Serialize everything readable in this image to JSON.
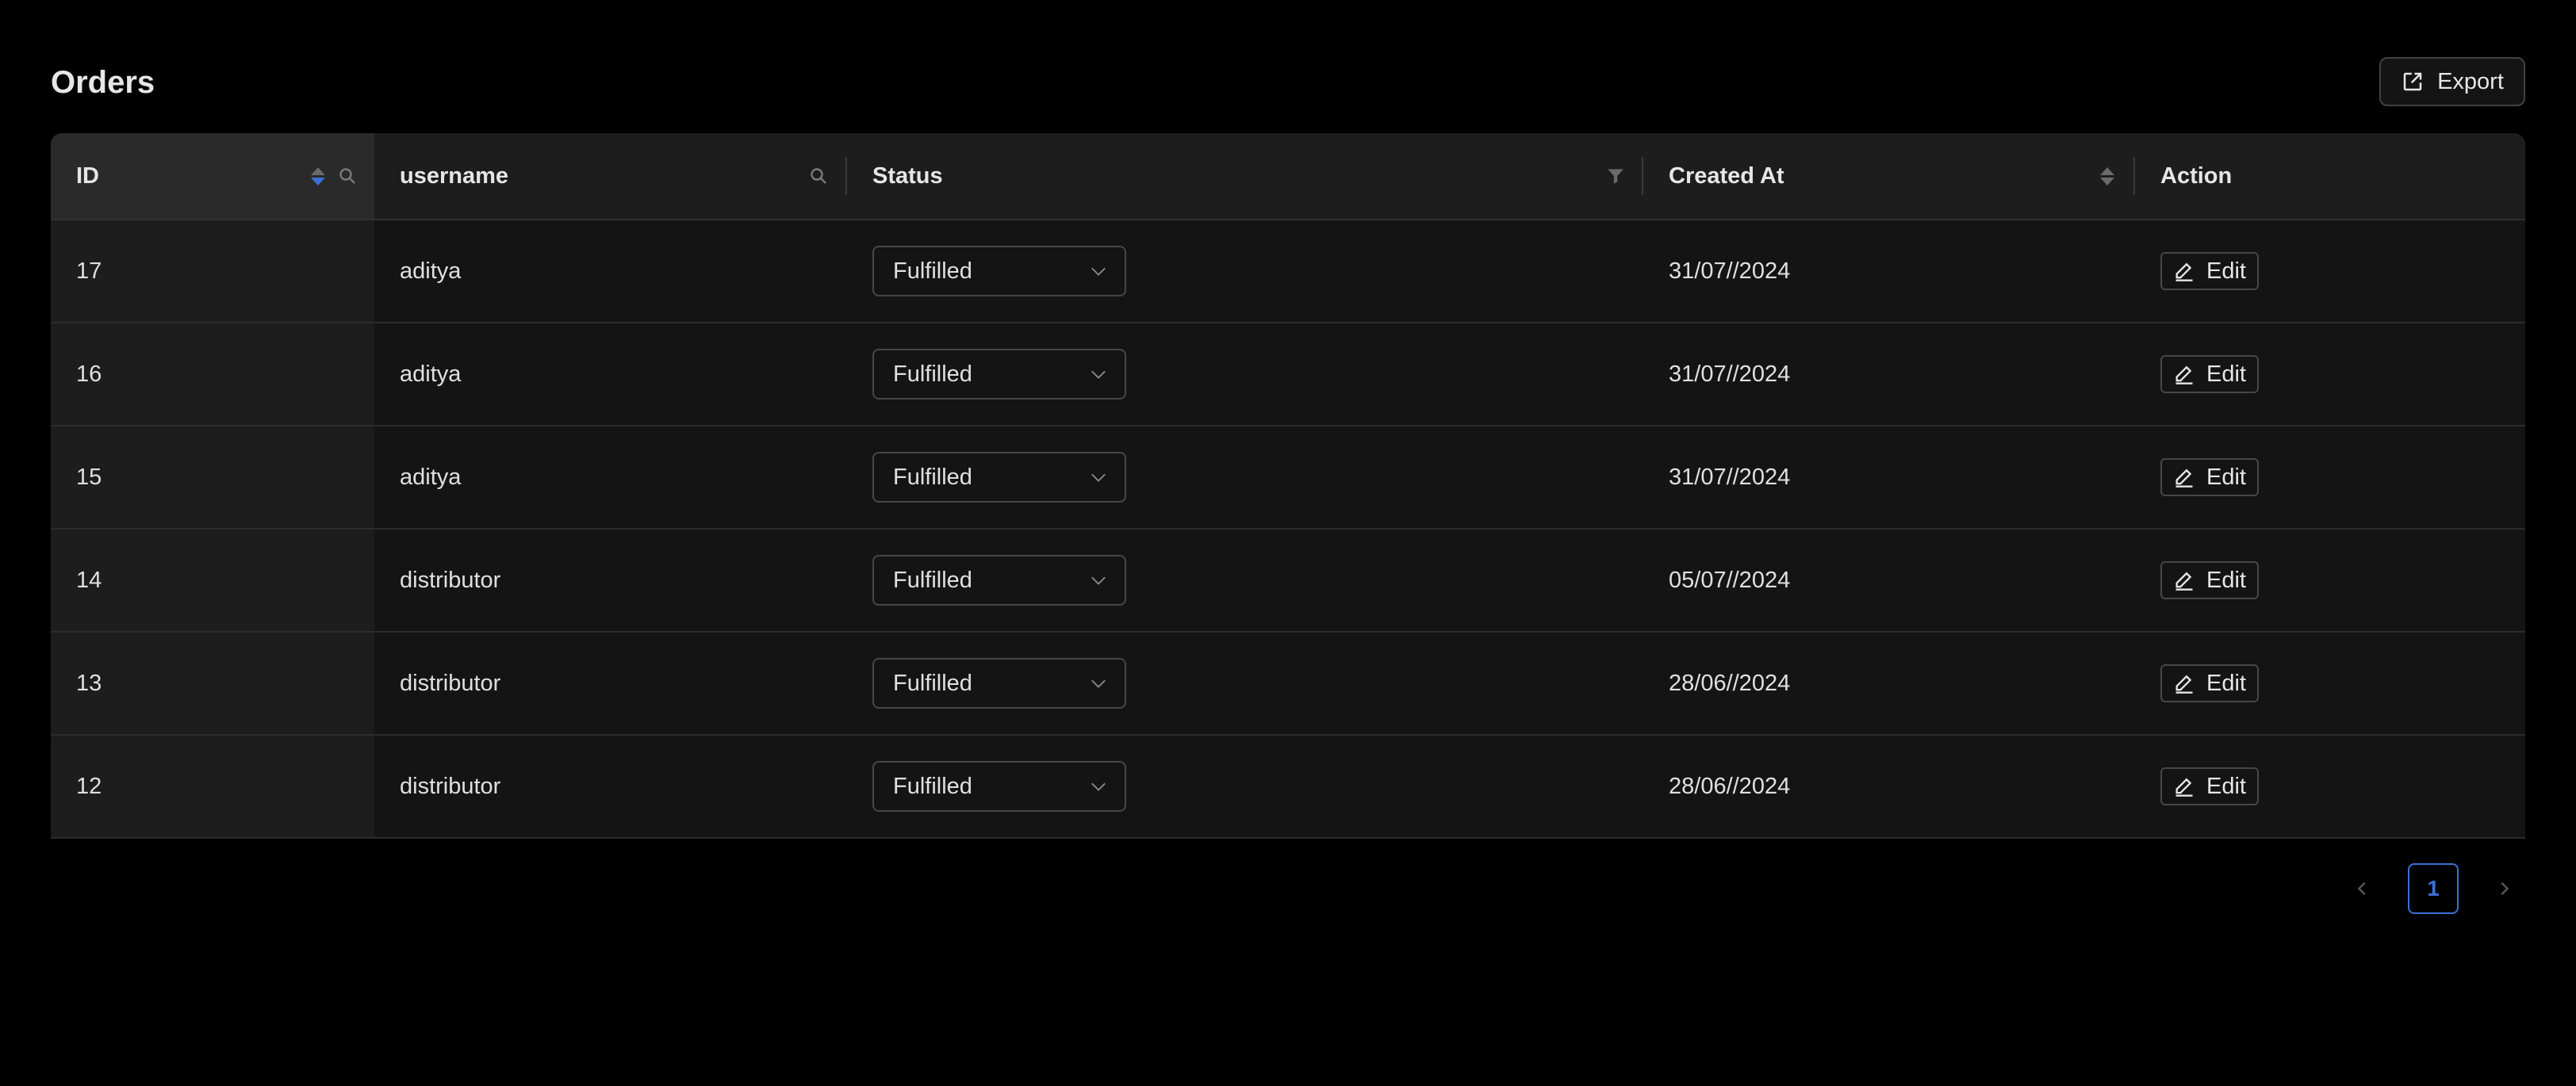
{
  "page": {
    "title": "Orders",
    "export_label": "Export"
  },
  "table": {
    "columns": [
      {
        "key": "id",
        "label": "ID",
        "sortable": true,
        "searchable": true,
        "sorted": "descend"
      },
      {
        "key": "username",
        "label": "username",
        "searchable": true
      },
      {
        "key": "status",
        "label": "Status",
        "filterable": true
      },
      {
        "key": "created_at",
        "label": "Created At",
        "sortable": true
      },
      {
        "key": "action",
        "label": "Action"
      }
    ],
    "rows": [
      {
        "id": "17",
        "username": "aditya",
        "status": "Fulfilled",
        "created_at": "31/07//2024",
        "action": "Edit"
      },
      {
        "id": "16",
        "username": "aditya",
        "status": "Fulfilled",
        "created_at": "31/07//2024",
        "action": "Edit"
      },
      {
        "id": "15",
        "username": "aditya",
        "status": "Fulfilled",
        "created_at": "31/07//2024",
        "action": "Edit"
      },
      {
        "id": "14",
        "username": "distributor",
        "status": "Fulfilled",
        "created_at": "05/07//2024",
        "action": "Edit"
      },
      {
        "id": "13",
        "username": "distributor",
        "status": "Fulfilled",
        "created_at": "28/06//2024",
        "action": "Edit"
      },
      {
        "id": "12",
        "username": "distributor",
        "status": "Fulfilled",
        "created_at": "28/06//2024",
        "action": "Edit"
      }
    ]
  },
  "pagination": {
    "current_page": "1"
  },
  "icons": {
    "export": "export-icon",
    "search": "search-icon",
    "sort": "sort-icon",
    "filter": "filter-icon",
    "chevron": "chevron-down-icon",
    "edit": "edit-icon",
    "prev": "chevron-left-icon",
    "next": "chevron-right-icon"
  },
  "colors": {
    "background": "#000000",
    "table_bg": "#141414",
    "header_bg": "#1d1d1d",
    "accent": "#3c6fd6",
    "text": "#e0e0e0"
  }
}
